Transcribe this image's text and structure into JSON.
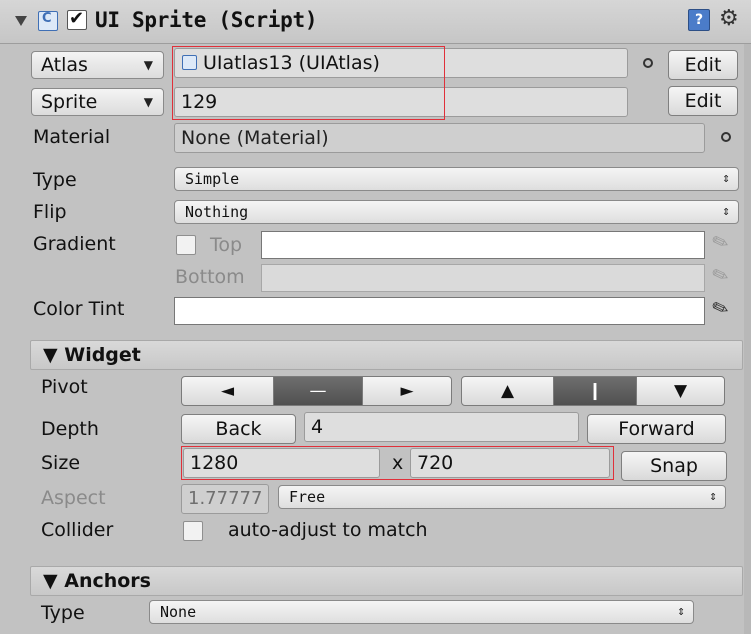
{
  "header": {
    "title": "UI Sprite (Script)",
    "enabled": true,
    "help_glyph": "?",
    "settings_glyph": "⚙"
  },
  "fields": {
    "atlas": {
      "dropdown_label": "Atlas",
      "value": "UIatlas13 (UIAtlas)",
      "edit_label": "Edit"
    },
    "sprite": {
      "dropdown_label": "Sprite",
      "value": "129",
      "edit_label": "Edit"
    },
    "material": {
      "label": "Material",
      "value": "None (Material)"
    },
    "type": {
      "label": "Type",
      "value": "Simple"
    },
    "flip": {
      "label": "Flip",
      "value": "Nothing"
    },
    "gradient": {
      "label": "Gradient",
      "top_label": "Top",
      "bottom_label": "Bottom",
      "enabled": false
    },
    "color_tint": {
      "label": "Color Tint",
      "color": "#ffffff"
    }
  },
  "widget": {
    "section_label": "Widget",
    "pivot_label": "Pivot",
    "pivot_buttons": [
      "◄",
      "—",
      "►",
      "▲",
      "❙",
      "▼"
    ],
    "depth_label": "Depth",
    "back_label": "Back",
    "depth_value": "4",
    "forward_label": "Forward",
    "size_label": "Size",
    "width": "1280",
    "height": "720",
    "size_separator": "x",
    "snap_label": "Snap",
    "aspect_label": "Aspect",
    "aspect_value": "1.77777",
    "aspect_mode": "Free",
    "collider_label": "Collider",
    "collider_text": "auto-adjust to match",
    "collider_checked": false
  },
  "anchors": {
    "section_label": "Anchors",
    "type_label": "Type",
    "type_value": "None"
  },
  "colors": {
    "highlight": "#e0303a",
    "panel_bg": "#c2c2c2"
  }
}
